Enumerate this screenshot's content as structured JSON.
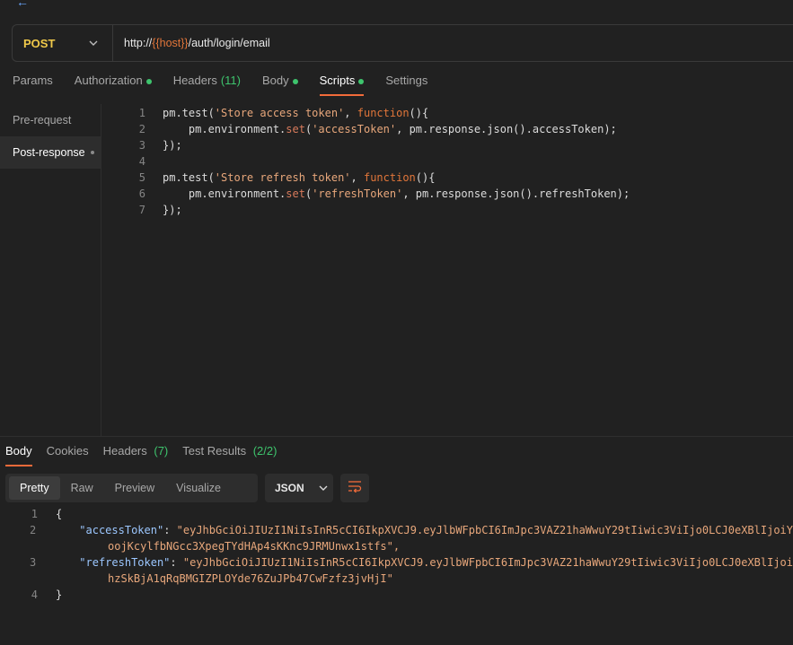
{
  "request": {
    "method": "POST",
    "url_prefix": "http://",
    "url_var": "{{host}}",
    "url_path": "/auth/login/email"
  },
  "request_tabs": [
    {
      "label": "Params"
    },
    {
      "label": "Authorization",
      "dot": true
    },
    {
      "label": "Headers",
      "count": "(11)"
    },
    {
      "label": "Body",
      "dot": true
    },
    {
      "label": "Scripts",
      "dot": true,
      "active": true
    },
    {
      "label": "Settings"
    }
  ],
  "script_nav": {
    "pre_request": "Pre-request",
    "post_response": "Post-response"
  },
  "editor": {
    "line_numbers": [
      "1",
      "2",
      "3",
      "4",
      "5",
      "6",
      "7"
    ],
    "l1": {
      "a": "pm.test(",
      "str": "'Store access token'",
      "b": ", ",
      "kw": "function",
      "c": "(){"
    },
    "l2": {
      "a": "    pm.environment.",
      "fn": "set",
      "b": "(",
      "str": "'accessToken'",
      "c": ", pm.response.json().accessToken);"
    },
    "l3": {
      "a": "});"
    },
    "l4": {
      "a": ""
    },
    "l5": {
      "a": "pm.test(",
      "str": "'Store refresh token'",
      "b": ", ",
      "kw": "function",
      "c": "(){"
    },
    "l6": {
      "a": "    pm.environment.",
      "fn": "set",
      "b": "(",
      "str": "'refreshToken'",
      "c": ", pm.response.json().refreshToken);"
    },
    "l7": {
      "a": "});"
    }
  },
  "response_tabs": [
    {
      "label": "Body",
      "active": true
    },
    {
      "label": "Cookies"
    },
    {
      "label": "Headers",
      "count": "(7)"
    },
    {
      "label": "Test Results",
      "count": "(2/2)"
    }
  ],
  "view_modes": [
    "Pretty",
    "Raw",
    "Preview",
    "Visualize"
  ],
  "format": "JSON",
  "response": {
    "line_numbers": [
      "1",
      "2",
      "3",
      "4"
    ],
    "open_brace": "{",
    "close_brace": "}",
    "access_key": "\"accessToken\"",
    "access_val_1": "\"eyJhbGciOiJIUzI1NiIsInR5cCI6IkpXVCJ9.eyJlbWFpbCI6ImJpc3VAZ21haWwuY29tIiwic3ViIjo0LCJ0eXBlIjoiY",
    "access_val_2": "oojKcylfbNGcc3XpegTYdHAp4sKKnc9JRMUnwx1stfs\",",
    "refresh_key": "\"refreshToken\"",
    "refresh_val_1": "\"eyJhbGciOiJIUzI1NiIsInR5cCI6IkpXVCJ9.eyJlbWFpbCI6ImJpc3VAZ21haWwuY29tIiwic3ViIjo0LCJ0eXBlIjoi",
    "refresh_val_2": "hzSkBjA1qRqBMGIZPLOYde76ZuJPb47CwFzfz3jvHjI\""
  },
  "colors": {
    "accent": "#f26b3a",
    "method": "#f0c94a",
    "status_dot": "#3ec46d",
    "json_key": "#9cc7ff",
    "json_string": "#e8a77b"
  }
}
